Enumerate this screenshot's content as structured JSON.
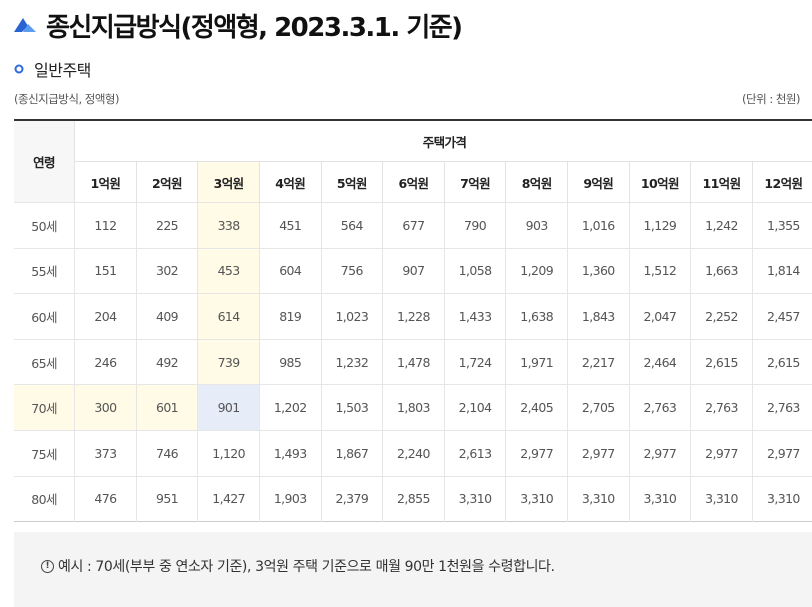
{
  "title": "종신지급방식(정액형, 2023.3.1. 기준)",
  "subtitle": "일반주택",
  "note_left": "(종신지급방식, 정액형)",
  "note_right": "(단위 : 천원)",
  "table": {
    "age_header": "연령",
    "price_header": "주택가격",
    "prices": [
      "1억원",
      "2억원",
      "3억원",
      "4억원",
      "5억원",
      "6억원",
      "7억원",
      "8억원",
      "9억원",
      "10억원",
      "11억원",
      "12억원"
    ],
    "rows": [
      {
        "age": "50세",
        "values": [
          "112",
          "225",
          "338",
          "451",
          "564",
          "677",
          "790",
          "903",
          "1,016",
          "1,129",
          "1,242",
          "1,355"
        ]
      },
      {
        "age": "55세",
        "values": [
          "151",
          "302",
          "453",
          "604",
          "756",
          "907",
          "1,058",
          "1,209",
          "1,360",
          "1,512",
          "1,663",
          "1,814"
        ]
      },
      {
        "age": "60세",
        "values": [
          "204",
          "409",
          "614",
          "819",
          "1,023",
          "1,228",
          "1,433",
          "1,638",
          "1,843",
          "2,047",
          "2,252",
          "2,457"
        ]
      },
      {
        "age": "65세",
        "values": [
          "246",
          "492",
          "739",
          "985",
          "1,232",
          "1,478",
          "1,724",
          "1,971",
          "2,217",
          "2,464",
          "2,615",
          "2,615"
        ]
      },
      {
        "age": "70세",
        "values": [
          "300",
          "601",
          "901",
          "1,202",
          "1,503",
          "1,803",
          "2,104",
          "2,405",
          "2,705",
          "2,763",
          "2,763",
          "2,763"
        ]
      },
      {
        "age": "75세",
        "values": [
          "373",
          "746",
          "1,120",
          "1,493",
          "1,867",
          "2,240",
          "2,613",
          "2,977",
          "2,977",
          "2,977",
          "2,977",
          "2,977"
        ]
      },
      {
        "age": "80세",
        "values": [
          "476",
          "951",
          "1,427",
          "1,903",
          "2,379",
          "2,855",
          "3,310",
          "3,310",
          "3,310",
          "3,310",
          "3,310",
          "3,310"
        ]
      }
    ]
  },
  "example": {
    "icon": "!",
    "text": "예시 : 70세(부부 중 연소자 기준), 3억원 주택 기준으로 매월 90만 1천원을 수령합니다."
  },
  "colors": {
    "highlight_yellow": "#fffbe6",
    "highlight_blue": "#e6edf9",
    "title_icon": "#2d6bdc"
  }
}
